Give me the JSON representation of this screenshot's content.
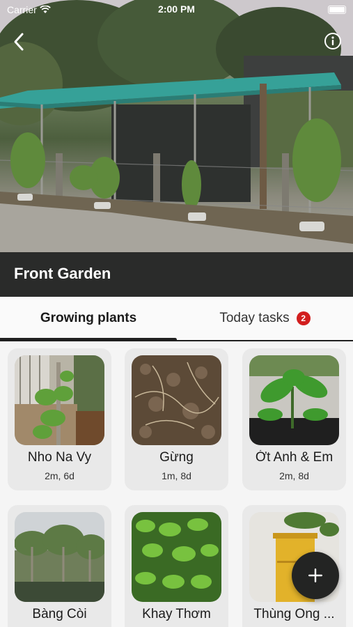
{
  "status_bar": {
    "carrier": "Carrier",
    "time": "2:00 PM"
  },
  "garden": {
    "title": "Front Garden"
  },
  "tabs": [
    {
      "label": "Growing plants",
      "active": true
    },
    {
      "label": "Today tasks",
      "badge": "2",
      "active": false
    }
  ],
  "plants": [
    {
      "name": "Nho Na Vy",
      "age": "2m, 6d",
      "image": "grape-vine"
    },
    {
      "name": "Gừng",
      "age": "1m, 8d",
      "image": "soil-ginger"
    },
    {
      "name": "Ớt Anh & Em",
      "age": "2m, 8d",
      "image": "chili-seedling"
    },
    {
      "name": "Bàng Còi",
      "age": "",
      "image": "banana-trees"
    },
    {
      "name": "Khay Thơm",
      "age": "",
      "image": "herb-tray"
    },
    {
      "name": "Thùng Ong ...",
      "age": "",
      "image": "bee-box"
    }
  ],
  "colors": {
    "header_dark": "#2a2b2a",
    "badge_red": "#d21e1e",
    "card_bg": "#e9e9e9"
  },
  "icons": {
    "back": "chevron-left-icon",
    "info": "info-icon",
    "add": "plus-icon",
    "wifi": "wifi-icon",
    "battery": "battery-icon"
  }
}
